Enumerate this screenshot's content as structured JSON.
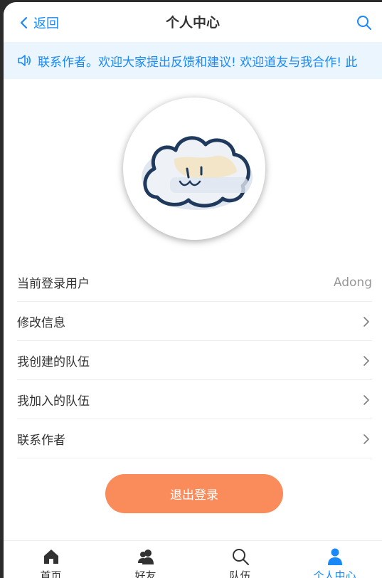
{
  "navbar": {
    "back_label": "返回",
    "title": "个人中心"
  },
  "notice": {
    "text": "联系作者。欢迎大家提出反馈和建议! 欢迎道友与我合作!  此"
  },
  "profile": {
    "cells": [
      {
        "label": "当前登录用户",
        "value": "Adong"
      },
      {
        "label": "修改信息"
      },
      {
        "label": "我创建的队伍"
      },
      {
        "label": "我加入的队伍"
      },
      {
        "label": "联系作者"
      }
    ]
  },
  "logout_label": "退出登录",
  "tabbar": {
    "tabs": [
      {
        "label": "首页",
        "icon": "home-icon"
      },
      {
        "label": "好友",
        "icon": "friends-icon"
      },
      {
        "label": "队伍",
        "icon": "search-icon"
      },
      {
        "label": "个人中心",
        "icon": "user-icon",
        "active": true
      }
    ]
  },
  "colors": {
    "accent": "#1989fa",
    "notice_bg": "#eaf5fd",
    "logout_bg": "#fa8c5c"
  }
}
